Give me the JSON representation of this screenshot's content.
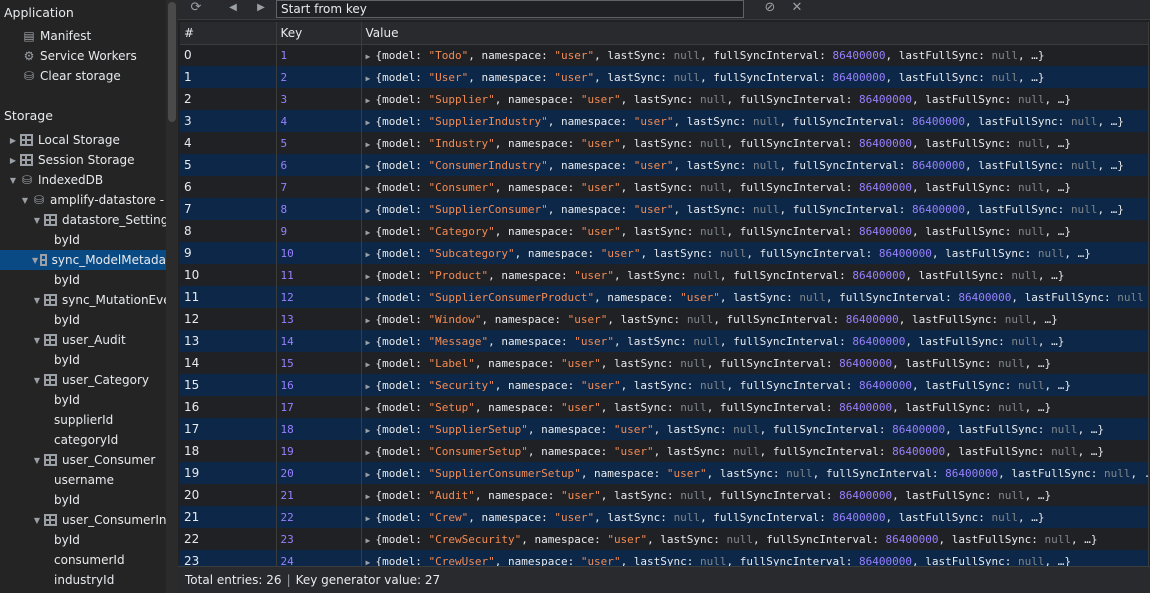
{
  "sidebar": {
    "application_header": "Application",
    "app_items": [
      {
        "label": "Manifest",
        "icon": "file-icon"
      },
      {
        "label": "Service Workers",
        "icon": "gear-icon"
      },
      {
        "label": "Clear storage",
        "icon": "database-icon"
      }
    ],
    "storage_header": "Storage",
    "storage_items": [
      {
        "label": "Local Storage",
        "icon": "grid-icon",
        "arrow": "▶"
      },
      {
        "label": "Session Storage",
        "icon": "grid-icon",
        "arrow": "▶"
      },
      {
        "label": "IndexedDB",
        "icon": "database-icon",
        "arrow": "▼"
      },
      {
        "label": "amplify-datastore - ht",
        "icon": "database-icon",
        "arrow": "▼"
      },
      {
        "label": "datastore_Setting",
        "icon": "grid-icon",
        "arrow": "▼"
      },
      {
        "label": "byId",
        "icon": "",
        "arrow": ""
      },
      {
        "label": "sync_ModelMetada",
        "icon": "grid-icon",
        "arrow": "▼",
        "selected": true
      },
      {
        "label": "byId",
        "icon": "",
        "arrow": ""
      },
      {
        "label": "sync_MutationEven",
        "icon": "grid-icon",
        "arrow": "▼"
      },
      {
        "label": "byId",
        "icon": "",
        "arrow": ""
      },
      {
        "label": "user_Audit",
        "icon": "grid-icon",
        "arrow": "▼"
      },
      {
        "label": "byId",
        "icon": "",
        "arrow": ""
      },
      {
        "label": "user_Category",
        "icon": "grid-icon",
        "arrow": "▼"
      },
      {
        "label": "byId",
        "icon": "",
        "arrow": ""
      },
      {
        "label": "supplierId",
        "icon": "",
        "arrow": ""
      },
      {
        "label": "categoryId",
        "icon": "",
        "arrow": ""
      },
      {
        "label": "user_Consumer",
        "icon": "grid-icon",
        "arrow": "▼"
      },
      {
        "label": "username",
        "icon": "",
        "arrow": ""
      },
      {
        "label": "byId",
        "icon": "",
        "arrow": ""
      },
      {
        "label": "user_ConsumerIndu",
        "icon": "grid-icon",
        "arrow": "▼"
      },
      {
        "label": "byId",
        "icon": "",
        "arrow": ""
      },
      {
        "label": "consumerId",
        "icon": "",
        "arrow": ""
      },
      {
        "label": "industryId",
        "icon": "",
        "arrow": ""
      }
    ]
  },
  "toolbar": {
    "refresh_icon": "refresh-icon",
    "prev_icon": "triangle-left-icon",
    "next_icon": "triangle-right-icon",
    "key_placeholder": "Start from key",
    "clear_icon": "block-icon",
    "delete_icon": "close-icon"
  },
  "table": {
    "columns": [
      "#",
      "Key",
      "Value"
    ],
    "rows": [
      {
        "idx": "0",
        "key": "1",
        "model": "Todo",
        "variant": "a"
      },
      {
        "idx": "1",
        "key": "2",
        "model": "User",
        "variant": "a"
      },
      {
        "idx": "2",
        "key": "3",
        "model": "Supplier",
        "variant": "a"
      },
      {
        "idx": "3",
        "key": "4",
        "model": "SupplierIndustry",
        "variant": "a"
      },
      {
        "idx": "4",
        "key": "5",
        "model": "Industry",
        "variant": "a"
      },
      {
        "idx": "5",
        "key": "6",
        "model": "ConsumerIndustry",
        "variant": "a"
      },
      {
        "idx": "6",
        "key": "7",
        "model": "Consumer",
        "variant": "a"
      },
      {
        "idx": "7",
        "key": "8",
        "model": "SupplierConsumer",
        "variant": "a"
      },
      {
        "idx": "8",
        "key": "9",
        "model": "Category",
        "variant": "a"
      },
      {
        "idx": "9",
        "key": "10",
        "model": "Subcategory",
        "variant": "a"
      },
      {
        "idx": "10",
        "key": "11",
        "model": "Product",
        "variant": "a"
      },
      {
        "idx": "11",
        "key": "12",
        "model": "SupplierConsumerProduct",
        "variant": "b"
      },
      {
        "idx": "12",
        "key": "13",
        "model": "Window",
        "variant": "a"
      },
      {
        "idx": "13",
        "key": "14",
        "model": "Message",
        "variant": "a"
      },
      {
        "idx": "14",
        "key": "15",
        "model": "Label",
        "variant": "a"
      },
      {
        "idx": "15",
        "key": "16",
        "model": "Security",
        "variant": "a"
      },
      {
        "idx": "16",
        "key": "17",
        "model": "Setup",
        "variant": "a"
      },
      {
        "idx": "17",
        "key": "18",
        "model": "SupplierSetup",
        "variant": "a"
      },
      {
        "idx": "18",
        "key": "19",
        "model": "ConsumerSetup",
        "variant": "a"
      },
      {
        "idx": "19",
        "key": "20",
        "model": "SupplierConsumerSetup",
        "variant": "c"
      },
      {
        "idx": "20",
        "key": "21",
        "model": "Audit",
        "variant": "a"
      },
      {
        "idx": "21",
        "key": "22",
        "model": "Crew",
        "variant": "a"
      },
      {
        "idx": "22",
        "key": "23",
        "model": "CrewSecurity",
        "variant": "a"
      },
      {
        "idx": "23",
        "key": "24",
        "model": "CrewUser",
        "variant": "a"
      }
    ],
    "value_parts": {
      "open": "{model: ",
      "ns_label": ", namespace: ",
      "ns_value": "user",
      "ls_label": ", lastSync: ",
      "null": "null",
      "fsi_label": ", fullSyncInterval: ",
      "fsi_value": "86400000",
      "lfs_label": ", lastFullSync: ",
      "close": ", …}",
      "cut_b": "null",
      "cut_c": ", ..."
    }
  },
  "footer": {
    "total_entries": "Total entries: 26",
    "separator": "|",
    "key_generator": "Key generator value: 27"
  },
  "colors": {
    "selected": "#0a4a84",
    "odd_row": "#0c2747",
    "string": "#f28b54",
    "number": "#9980ff"
  }
}
